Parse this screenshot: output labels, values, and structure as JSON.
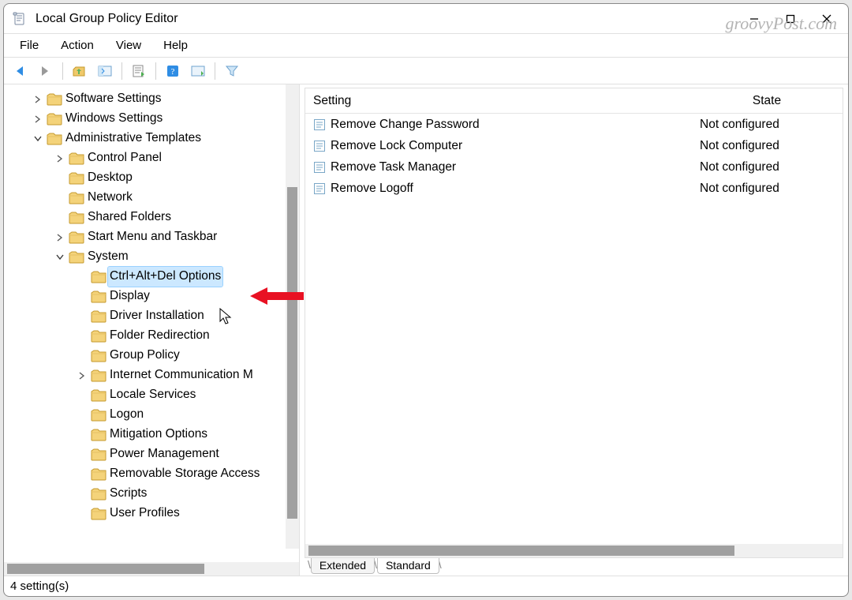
{
  "window": {
    "title": "Local Group Policy Editor"
  },
  "watermark": "groovyPost.com",
  "menu": {
    "file": "File",
    "action": "Action",
    "view": "View",
    "help": "Help"
  },
  "tree": {
    "items": [
      {
        "indent": 1,
        "expander": "closed",
        "label": "Software Settings"
      },
      {
        "indent": 1,
        "expander": "closed",
        "label": "Windows Settings"
      },
      {
        "indent": 1,
        "expander": "open",
        "label": "Administrative Templates"
      },
      {
        "indent": 2,
        "expander": "closed",
        "label": "Control Panel"
      },
      {
        "indent": 2,
        "expander": "none",
        "label": "Desktop"
      },
      {
        "indent": 2,
        "expander": "none",
        "label": "Network"
      },
      {
        "indent": 2,
        "expander": "none",
        "label": "Shared Folders"
      },
      {
        "indent": 2,
        "expander": "closed",
        "label": "Start Menu and Taskbar"
      },
      {
        "indent": 2,
        "expander": "open",
        "label": "System"
      },
      {
        "indent": 3,
        "expander": "none",
        "label": "Ctrl+Alt+Del Options",
        "selected": true
      },
      {
        "indent": 3,
        "expander": "none",
        "label": "Display"
      },
      {
        "indent": 3,
        "expander": "none",
        "label": "Driver Installation"
      },
      {
        "indent": 3,
        "expander": "none",
        "label": "Folder Redirection"
      },
      {
        "indent": 3,
        "expander": "none",
        "label": "Group Policy"
      },
      {
        "indent": 3,
        "expander": "closed",
        "label": "Internet Communication M"
      },
      {
        "indent": 3,
        "expander": "none",
        "label": "Locale Services"
      },
      {
        "indent": 3,
        "expander": "none",
        "label": "Logon"
      },
      {
        "indent": 3,
        "expander": "none",
        "label": "Mitigation Options"
      },
      {
        "indent": 3,
        "expander": "none",
        "label": "Power Management"
      },
      {
        "indent": 3,
        "expander": "none",
        "label": "Removable Storage Access"
      },
      {
        "indent": 3,
        "expander": "none",
        "label": "Scripts"
      },
      {
        "indent": 3,
        "expander": "none",
        "label": "User Profiles"
      }
    ]
  },
  "list": {
    "columns": {
      "setting": "Setting",
      "state": "State"
    },
    "rows": [
      {
        "setting": "Remove Change Password",
        "state": "Not configured"
      },
      {
        "setting": "Remove Lock Computer",
        "state": "Not configured"
      },
      {
        "setting": "Remove Task Manager",
        "state": "Not configured"
      },
      {
        "setting": "Remove Logoff",
        "state": "Not configured"
      }
    ]
  },
  "tabs": {
    "extended": "Extended",
    "standard": "Standard"
  },
  "status": {
    "text": "4 setting(s)"
  }
}
